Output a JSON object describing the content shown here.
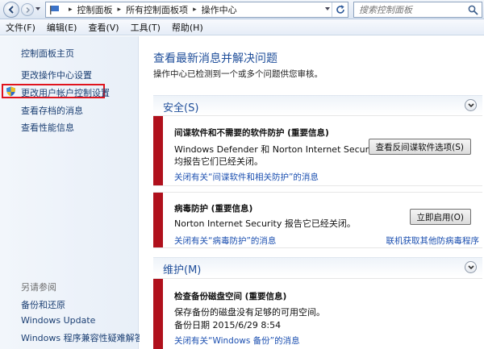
{
  "address": {
    "crumbs": [
      "控制面板",
      "所有控制面板项",
      "操作中心"
    ],
    "search_placeholder": "搜索控制面板"
  },
  "menu": [
    "文件(F)",
    "编辑(E)",
    "查看(V)",
    "工具(T)",
    "帮助(H)"
  ],
  "sidebar": {
    "items": [
      "控制面板主页",
      "更改操作中心设置",
      "更改用户帐户控制设置",
      "查看存档的消息",
      "查看性能信息"
    ],
    "see_also_label": "另请参阅",
    "see_also": [
      "备份和还原",
      "Windows Update",
      "Windows 程序兼容性疑难解答"
    ]
  },
  "main": {
    "heading": "查看最新消息并解决问题",
    "subheading": "操作中心已检测到一个或多个问题供您审核。",
    "security": {
      "title": "安全(S)",
      "spyware": {
        "title": "间谍软件和不需要的软件防护 (重要信息)",
        "body1": "Windows Defender 和 Norton Internet Security",
        "body2": "均报告它们已经关闭。",
        "link": "关闭有关“间谍软件和相关防护”的消息",
        "button": "查看反间谍软件选项(S)"
      },
      "virus": {
        "title": "病毒防护 (重要信息)",
        "body": "Norton Internet Security 报告它已经关闭。",
        "link": "关闭有关“病毒防护”的消息",
        "right_link": "联机获取其他防病毒程序",
        "button": "立即启用(O)"
      }
    },
    "maintenance": {
      "title": "维护(M)",
      "backup": {
        "title": "检查备份磁盘空间 (重要信息)",
        "body1": "保存备份的磁盘没有足够的可用空间。",
        "body2": "备份日期 2015/6/29 8:54",
        "link": "关闭有关“Windows 备份”的消息"
      }
    }
  }
}
